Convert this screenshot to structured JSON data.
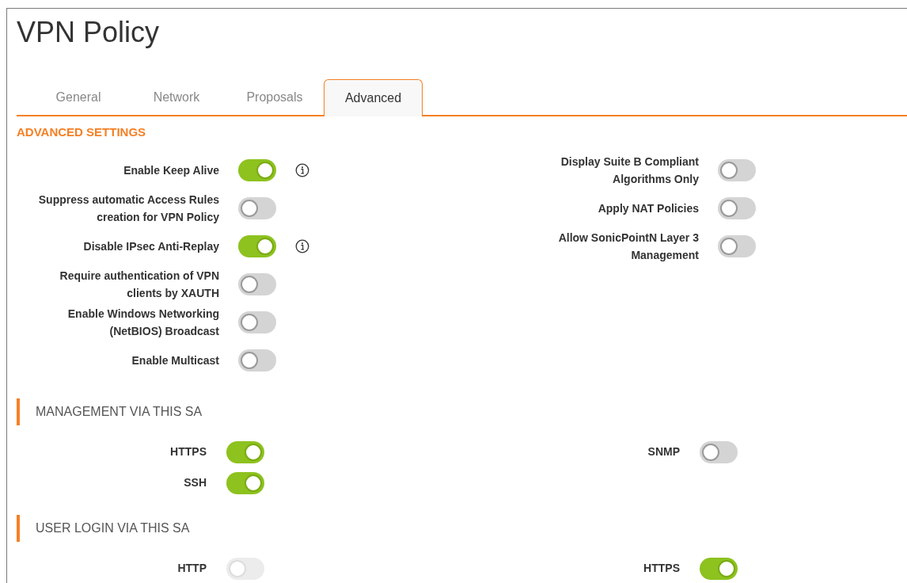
{
  "window": {
    "title": "VPN Policy"
  },
  "tabs": [
    {
      "label": "General",
      "selected": false
    },
    {
      "label": "Network",
      "selected": false
    },
    {
      "label": "Proposals",
      "selected": false
    },
    {
      "label": "Advanced",
      "selected": true
    }
  ],
  "advanced_settings": {
    "heading": "ADVANCED SETTINGS",
    "left": [
      {
        "label": "Enable Keep Alive",
        "on": true,
        "disabled": false,
        "info": true
      },
      {
        "label": "Suppress automatic Access Rules creation for VPN Policy",
        "on": false,
        "disabled": false,
        "info": false
      },
      {
        "label": "Disable IPsec Anti-Replay",
        "on": true,
        "disabled": false,
        "info": true
      },
      {
        "label": "Require authentication of VPN clients by XAUTH",
        "on": false,
        "disabled": false,
        "info": false
      },
      {
        "label": "Enable Windows Networking (NetBIOS) Broadcast",
        "on": false,
        "disabled": false,
        "info": false
      },
      {
        "label": "Enable Multicast",
        "on": false,
        "disabled": false,
        "info": false
      }
    ],
    "right": [
      {
        "label": "Display Suite B Compliant Algorithms Only",
        "on": false,
        "disabled": false,
        "info": false
      },
      {
        "label": "Apply NAT Policies",
        "on": false,
        "disabled": false,
        "info": false
      },
      {
        "label": "Allow SonicPointN Layer 3 Management",
        "on": false,
        "disabled": false,
        "info": false
      }
    ]
  },
  "sections": [
    {
      "heading": "MANAGEMENT VIA THIS SA",
      "left": [
        {
          "label": "HTTPS",
          "on": true,
          "disabled": false
        },
        {
          "label": "SSH",
          "on": true,
          "disabled": false
        }
      ],
      "right": [
        {
          "label": "SNMP",
          "on": false,
          "disabled": false
        }
      ]
    },
    {
      "heading": "USER LOGIN VIA THIS SA",
      "left": [
        {
          "label": "HTTP",
          "on": false,
          "disabled": true
        }
      ],
      "right": [
        {
          "label": "HTTPS",
          "on": true,
          "disabled": false
        }
      ]
    }
  ]
}
